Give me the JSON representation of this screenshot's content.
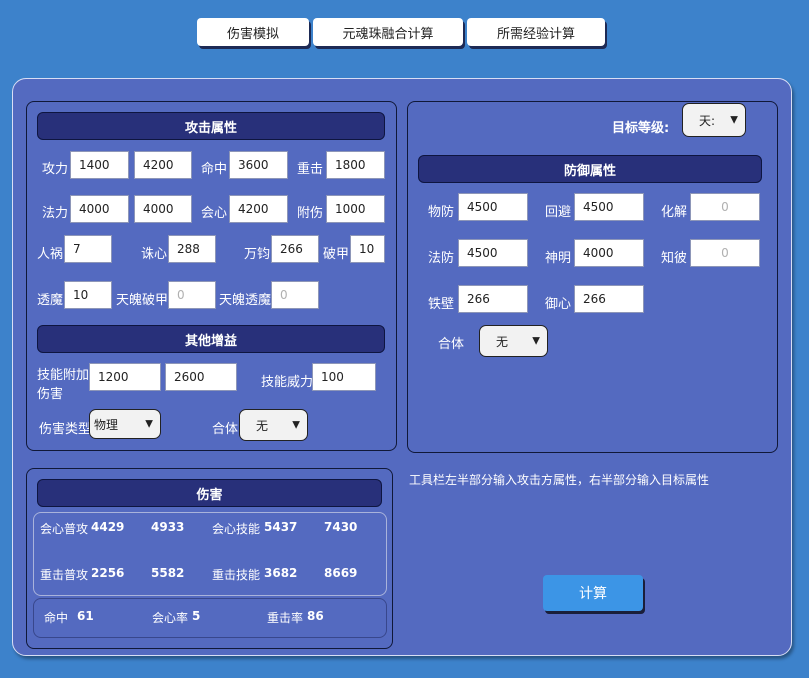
{
  "tabs": [
    "伤害模拟",
    "元魂珠融合计算",
    "所需经验计算"
  ],
  "attack": {
    "header": "攻击属性",
    "atk_label": "攻力",
    "atk_min": "1400",
    "atk_max": "4200",
    "hit_label": "命中",
    "hit": "3600",
    "heavy_label": "重击",
    "heavy": "1800",
    "mag_label": "法力",
    "mag_min": "4000",
    "mag_max": "4000",
    "crit_label": "会心",
    "crit": "4200",
    "addhurt_label": "附伤",
    "addhurt": "1000",
    "renhuo_label": "人祸",
    "renhuo": "7",
    "zhuxin_label": "诛心",
    "zhuxin": "288",
    "wanjun_label": "万钧",
    "wanjun": "266",
    "pojia_label": "破甲",
    "pojia": "10",
    "toumo_label": "透魔",
    "toumo": "10",
    "tianpojia_label": "天魄破甲",
    "tianpojia": "0",
    "tiantoumo_label": "天魄透魔",
    "tiantoumo": "0"
  },
  "other": {
    "header": "其他增益",
    "skilladd_label": "技能附加伤害",
    "skilladd_min": "1200",
    "skilladd_max": "2600",
    "skillpower_label": "技能威力",
    "skillpower": "100",
    "dmgtype_label": "伤害类型",
    "dmgtype": "物理",
    "heti_label": "合体",
    "heti": "无"
  },
  "target": {
    "level_label": "目标等级:",
    "level": "天:",
    "header": "防御属性",
    "wufang_label": "物防",
    "wufang": "4500",
    "huibi_label": "回避",
    "huibi": "4500",
    "huajie_label": "化解",
    "huajie": "0",
    "fafang_label": "法防",
    "fafang": "4500",
    "shenming_label": "神明",
    "shenming": "4000",
    "zhibi_label": "知彼",
    "zhibi": "0",
    "tiebi_label": "铁壁",
    "tiebi": "266",
    "yuxin_label": "御心",
    "yuxin": "266",
    "heti_label": "合体",
    "heti": "无"
  },
  "damage": {
    "header": "伤害",
    "crit_normal_label": "会心普攻",
    "crit_normal_min": "4429",
    "crit_normal_max": "4933",
    "crit_skill_label": "会心技能",
    "crit_skill_min": "5437",
    "crit_skill_max": "7430",
    "heavy_normal_label": "重击普攻",
    "heavy_normal_min": "2256",
    "heavy_normal_max": "5582",
    "heavy_skill_label": "重击技能",
    "heavy_skill_min": "3682",
    "heavy_skill_max": "8669",
    "hit_label": "命中",
    "hit_val": "61",
    "critrate_label": "会心率",
    "critrate_val": "5",
    "heavyrate_label": "重击率",
    "heavyrate_val": "86"
  },
  "hint": "工具栏左半部分输入攻击方属性，右半部分输入目标属性",
  "calc_button": "计算"
}
